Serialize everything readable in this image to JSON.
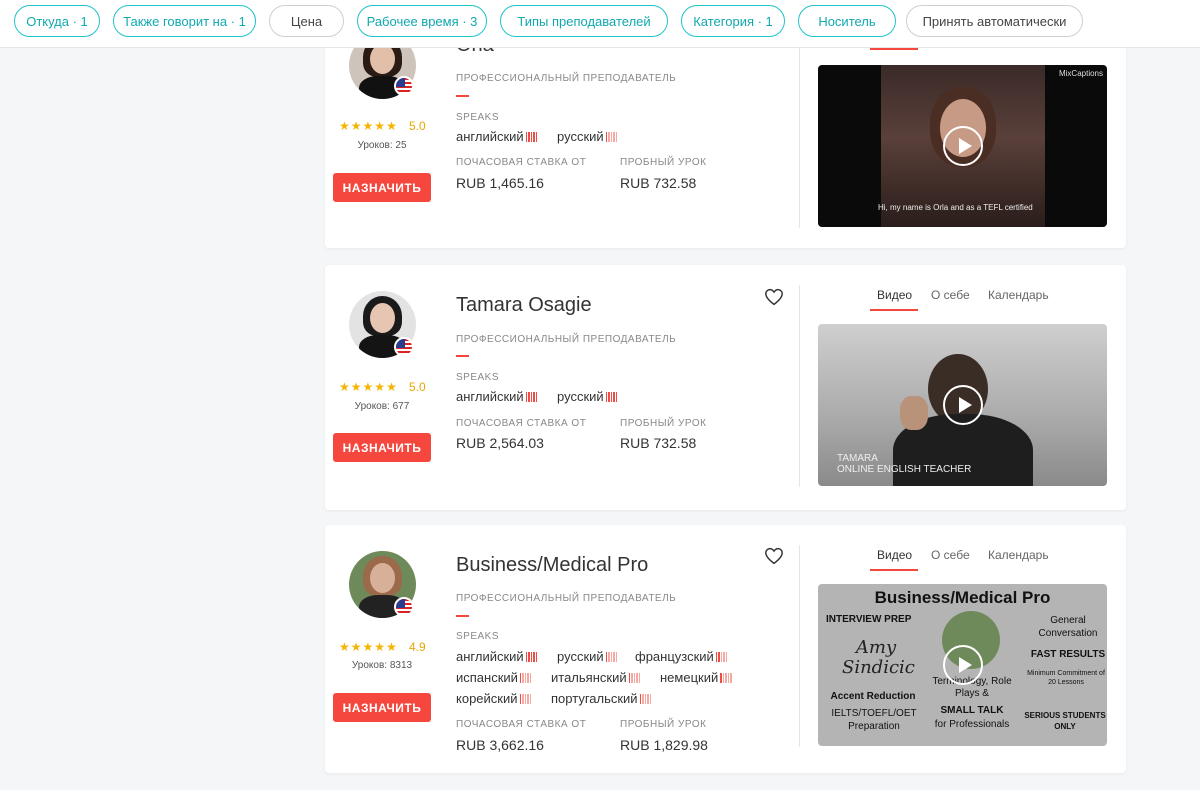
{
  "filters": [
    {
      "label": "Откуда · 1",
      "style": "accent"
    },
    {
      "label": "Также говорит на · 1",
      "style": "accent"
    },
    {
      "label": "Цена",
      "style": "plain"
    },
    {
      "label": "Рабочее время · 3",
      "style": "accent"
    },
    {
      "label": "Типы преподавателей",
      "style": "accent"
    },
    {
      "label": "Категория · 1",
      "style": "accent"
    },
    {
      "label": "Носитель",
      "style": "accent"
    },
    {
      "label": "Принять автоматически",
      "style": "plain"
    }
  ],
  "common": {
    "teacher_type": "ПРОФЕССИОНАЛЬНЫЙ ПРЕПОДАВАТЕЛЬ",
    "speaks_label": "SPEAKS",
    "hourly_label": "ПОЧАСОВАЯ СТАВКА ОТ",
    "trial_label": "ПРОБНЫЙ УРОК",
    "book_button": "НАЗНАЧИТЬ",
    "tabs": [
      "Видео",
      "О себе",
      "Календарь"
    ]
  },
  "colors": {
    "accent": "#20c3c9",
    "brand_red": "#f5473d",
    "star": "#f5b400"
  },
  "tutors": [
    {
      "name": "Orla",
      "rating": "5.0",
      "stars": 5,
      "lessons": "Уроков: 25",
      "languages": [
        {
          "name": "английский",
          "level": 5
        },
        {
          "name": "русский",
          "level": 1
        }
      ],
      "hourly_rate": "RUB 1,465.16",
      "trial_price": "RUB 732.58",
      "video_caption": "Hi, my name is Orla and as a TEFL certified",
      "video_watermark": "MixCaptions"
    },
    {
      "name": "Tamara Osagie",
      "rating": "5.0",
      "stars": 5,
      "lessons": "Уроков: 677",
      "languages": [
        {
          "name": "английский",
          "level": 5
        },
        {
          "name": "русский",
          "level": 5
        }
      ],
      "hourly_rate": "RUB 2,564.03",
      "trial_price": "RUB 732.58",
      "video_caption_1": "TAMARA",
      "video_caption_2": "ONLINE ENGLISH TEACHER"
    },
    {
      "name": "Business/Medical Pro",
      "rating": "4.9",
      "stars": 5,
      "lessons": "Уроков: 8313",
      "languages": [
        {
          "name": "английский",
          "level": 5
        },
        {
          "name": "русский",
          "level": 1
        },
        {
          "name": "французский",
          "level": 2
        },
        {
          "name": "испанский",
          "level": 1
        },
        {
          "name": "итальянский",
          "level": 1
        },
        {
          "name": "немецкий",
          "level": 1
        },
        {
          "name": "корейский",
          "level": 1
        },
        {
          "name": "португальский",
          "level": 1
        }
      ],
      "hourly_rate": "RUB 3,662.16",
      "trial_price": "RUB 1,829.98",
      "video": {
        "title": "Business/Medical Pro",
        "interview": "INTERVIEW PREP",
        "general": "General Conversation",
        "fast": "FAST RESULTS",
        "minimum": "Minimum Commitment of 20 Lessons",
        "signature": "Amy Sindicic",
        "accent": "Accent Reduction",
        "ielts": "IELTS/TOEFL/OET Preparation",
        "terminology": "Terminology, Role Plays &",
        "small_talk": "SMALL TALK",
        "for_pro": "for Professionals",
        "serious": "SERIOUS STUDENTS ONLY"
      }
    }
  ]
}
